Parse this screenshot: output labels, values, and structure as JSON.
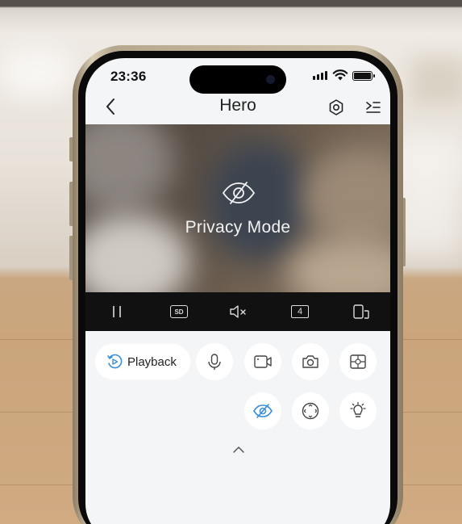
{
  "status_bar": {
    "time": "23:36"
  },
  "nav": {
    "title": "Hero",
    "back_icon": "chevron-left-icon",
    "settings_icon": "gear-icon",
    "menu_icon": "menu-icon"
  },
  "video": {
    "privacy_label": "Privacy Mode",
    "privacy_icon": "eye-off-icon"
  },
  "control_bar": {
    "pause_icon": "pause-icon",
    "quality_label": "SD",
    "mute_icon": "speaker-muted-icon",
    "split_count": "4",
    "rotate_icon": "orientation-icon"
  },
  "actions": {
    "playback_label": "Playback",
    "icons": [
      "microphone-icon",
      "record-video-icon",
      "camera-snapshot-icon",
      "multi-view-icon",
      "privacy-eye-icon",
      "ptz-control-icon",
      "light-icon",
      "chevron-up-icon"
    ]
  },
  "colors": {
    "accent": "#3a8fd8",
    "video_bar": "#111111",
    "screen_bg": "#f4f5f7"
  }
}
